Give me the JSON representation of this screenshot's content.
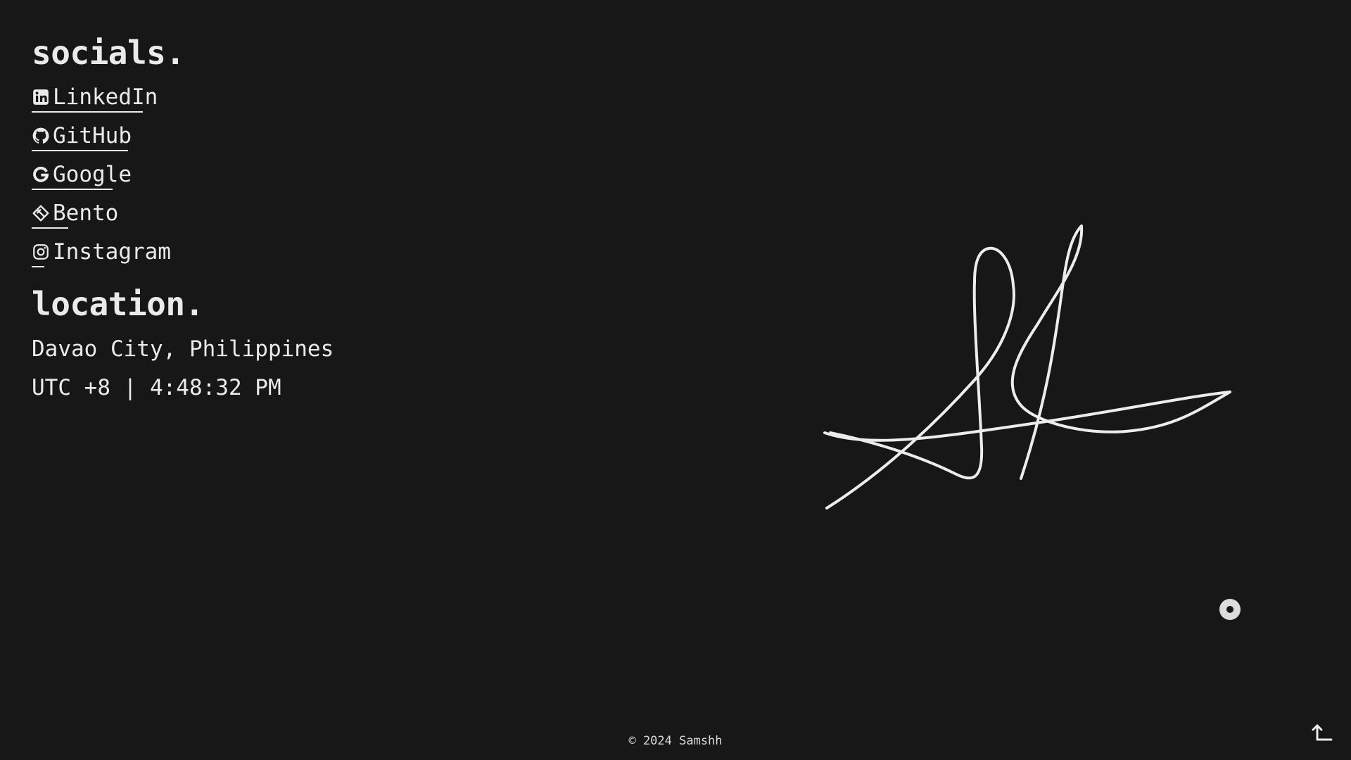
{
  "socials": {
    "title": "socials.",
    "items": [
      {
        "label": "LinkedIn",
        "icon": "linkedin-icon"
      },
      {
        "label": "GitHub",
        "icon": "github-icon"
      },
      {
        "label": "Google",
        "icon": "google-icon"
      },
      {
        "label": "Bento",
        "icon": "bento-icon"
      },
      {
        "label": "Instagram",
        "icon": "instagram-icon"
      }
    ]
  },
  "location": {
    "title": "location.",
    "city": "Davao City, Philippines",
    "time": "UTC +8 | 4:48:32 PM"
  },
  "footer": {
    "copyright": "© 2024 Samshh"
  },
  "colors": {
    "background": "#171717",
    "foreground": "#eaeaea"
  }
}
